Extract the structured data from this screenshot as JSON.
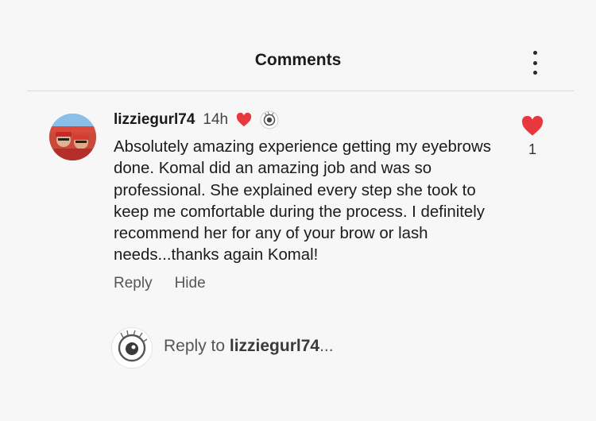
{
  "header": {
    "title": "Comments",
    "menu_icon": "more-vertical-icon"
  },
  "comment": {
    "username": "lizziegurl74",
    "time": "14h",
    "creator_heart_icon": "heart-icon",
    "creator_badge_icon": "brand-logo-icon",
    "text": "Absolutely amazing experience getting my eyebrows done. Komal did an amazing job and was so professional. She explained every step she took to keep me comfortable during the process. I definitely recommend her for any of your brow or lash needs...thanks again Komal!",
    "like_count": "1",
    "actions": {
      "reply": "Reply",
      "hide": "Hide"
    }
  },
  "reply_box": {
    "prefix": "Reply to ",
    "username": "lizziegurl74",
    "suffix": "..."
  },
  "colors": {
    "heart": "#e8383d",
    "text": "#1b1b1b",
    "muted": "#555555",
    "background": "#f7f7f7"
  }
}
